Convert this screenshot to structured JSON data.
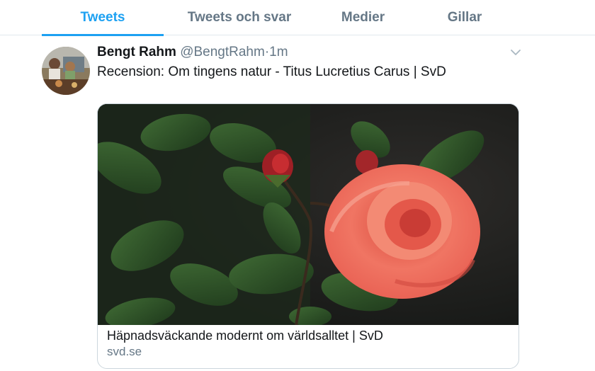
{
  "tabs": [
    {
      "label": "Tweets",
      "active": true
    },
    {
      "label": "Tweets och svar",
      "active": false
    },
    {
      "label": "Medier",
      "active": false
    },
    {
      "label": "Gillar",
      "active": false
    }
  ],
  "tweet": {
    "author_name": "Bengt Rahm",
    "author_handle": "@BengtRahm",
    "separator": "·",
    "time": "1m",
    "text": "Recension: Om tingens natur - Titus Lucretius Carus | SvD",
    "card": {
      "title": "Häpnadsväckande modernt om världsalltet | SvD",
      "domain": "svd.se",
      "image_icon": "rose-photo"
    }
  },
  "colors": {
    "accent": "#1da1f2",
    "secondary_text": "#657786",
    "border": "#e1e8ed"
  }
}
